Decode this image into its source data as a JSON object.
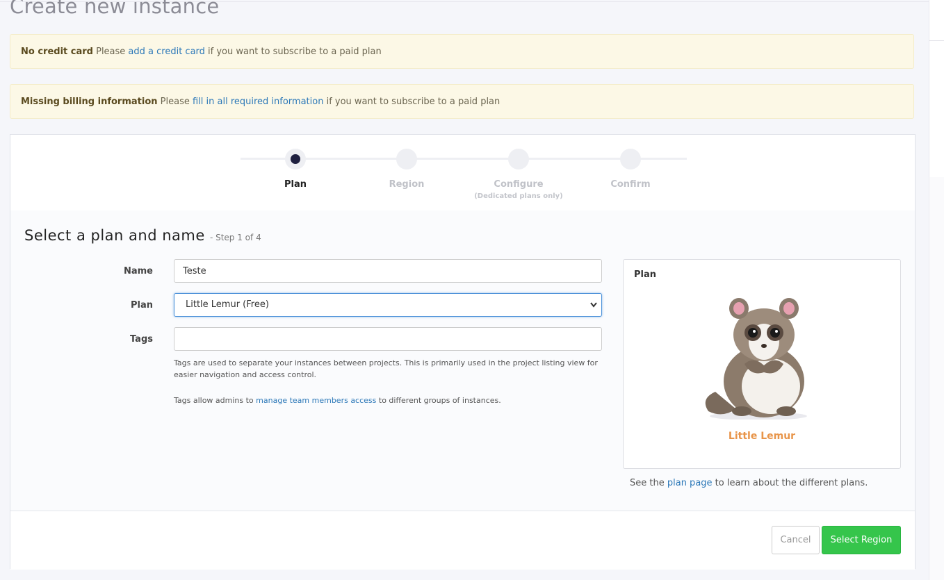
{
  "page": {
    "title": "Create new instance"
  },
  "alerts": [
    {
      "strong": "No credit card",
      "pre": " Please ",
      "link": "add a credit card",
      "post": " if you want to subscribe to a paid plan"
    },
    {
      "strong": "Missing billing information",
      "pre": " Please ",
      "link": "fill in all required information",
      "post": " if you want to subscribe to a paid plan"
    }
  ],
  "wizard": {
    "steps": [
      {
        "label": "Plan",
        "active": true
      },
      {
        "label": "Region",
        "active": false
      },
      {
        "label": "Configure",
        "sub": "(Dedicated plans only)",
        "active": false
      },
      {
        "label": "Confirm",
        "active": false
      }
    ]
  },
  "section": {
    "title": "Select a plan and name",
    "step_text": "- Step 1 of 4"
  },
  "form": {
    "name_label": "Name",
    "name_value": "Teste",
    "plan_label": "Plan",
    "plan_selected": "Little Lemur (Free)",
    "tags_label": "Tags",
    "tags_value": "",
    "help1": "Tags are used to separate your instances between projects. This is primarily used in the project listing view for easier navigation and access control.",
    "help2_pre": "Tags allow admins to ",
    "help2_link": "manage team members access",
    "help2_post": " to different groups of instances."
  },
  "plan_card": {
    "title": "Plan",
    "plan_name": "Little Lemur",
    "note_pre": "See the ",
    "note_link": "plan page",
    "note_post": " to learn about the different plans.",
    "accent_color": "#e8954a"
  },
  "footer": {
    "cancel_label": "Cancel",
    "primary_label": "Select Region",
    "primary_color": "#35c54b"
  }
}
